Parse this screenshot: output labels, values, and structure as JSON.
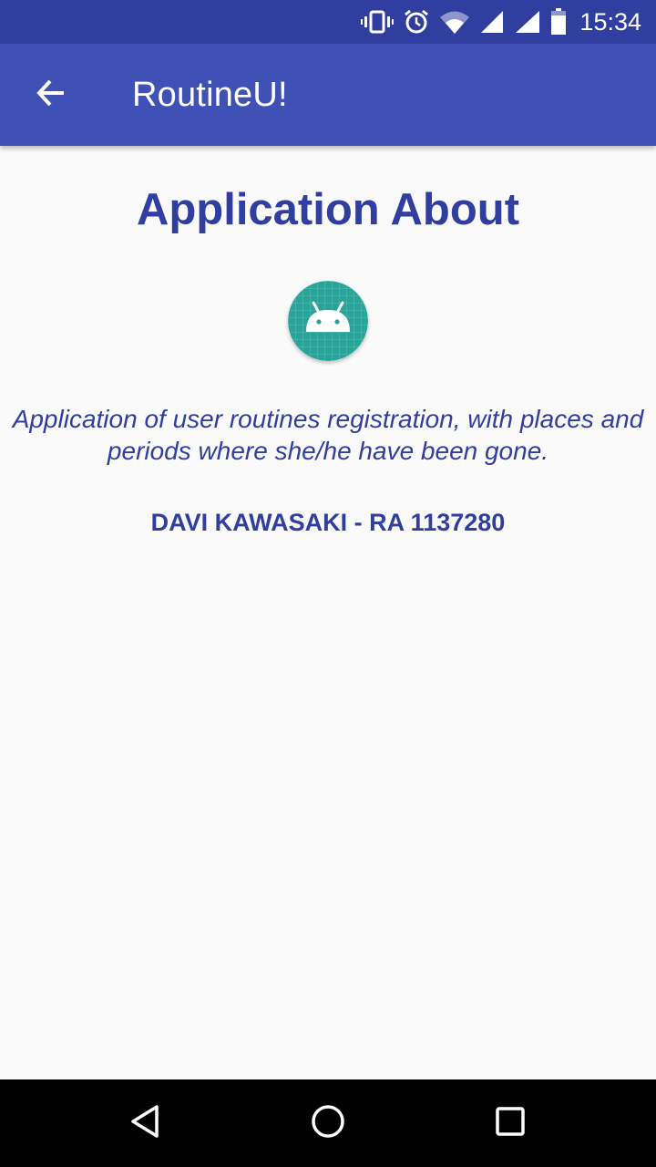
{
  "status_bar": {
    "time": "15:34",
    "icons": [
      "vibrate-icon",
      "alarm-icon",
      "wifi-icon",
      "signal-icon",
      "signal-icon",
      "battery-icon"
    ]
  },
  "app_bar": {
    "title": "RoutineU!",
    "back_icon": "arrow-back-icon"
  },
  "about": {
    "heading": "Application About",
    "logo_icon": "android-launcher-icon",
    "description": "Application of user routines registration, with places and periods where she/he have been gone.",
    "author": "DAVI KAWASAKI - RA 1137280"
  },
  "nav_bar": {
    "buttons": [
      "back-icon",
      "home-icon",
      "recents-icon"
    ]
  },
  "colors": {
    "status_bar": "#303f9f",
    "app_bar": "#3f51b5",
    "text_primary": "#303f9f",
    "logo_bg": "#26a69a",
    "background": "#fafafa"
  }
}
